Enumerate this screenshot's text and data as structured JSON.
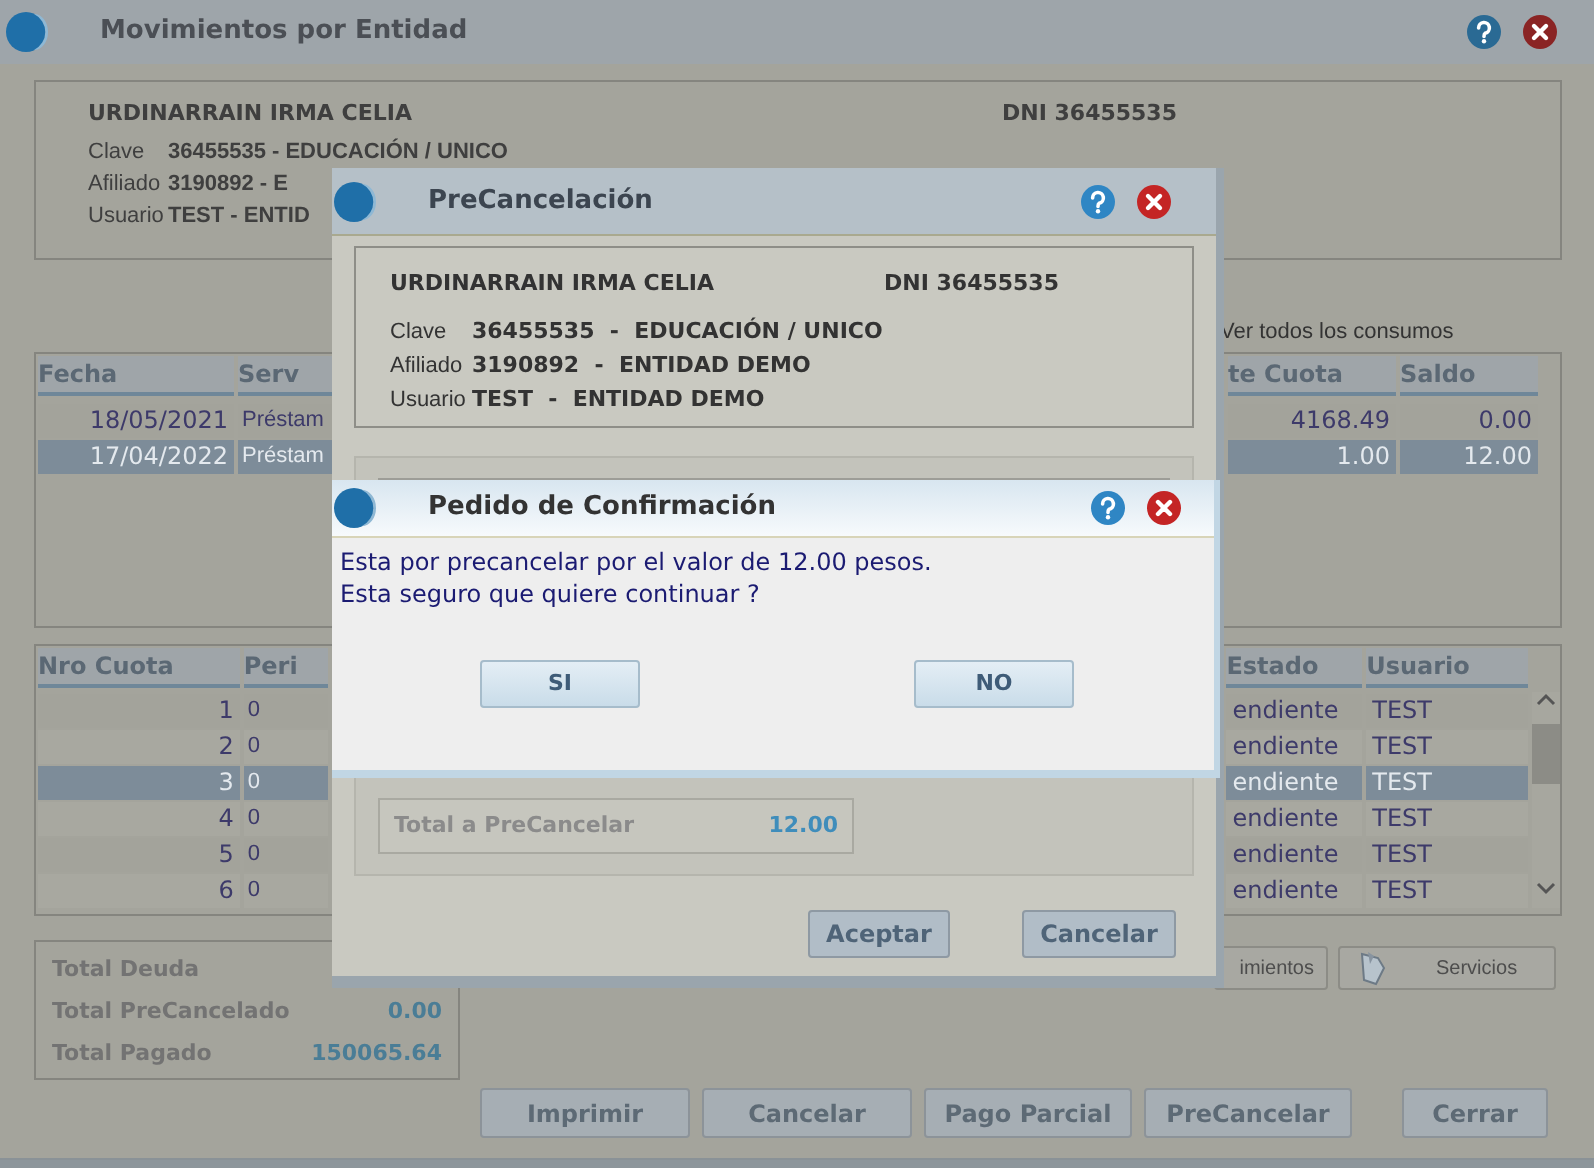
{
  "main": {
    "title": "Movimientos por Entidad",
    "header": {
      "name": "URDINARRAIN IRMA CELIA",
      "dni": "DNI 36455535",
      "rows": [
        {
          "label": "Clave",
          "value": "36455535 - EDUCACIÓN / UNICO"
        },
        {
          "label": "Afiliado",
          "value": "3190892 - E"
        },
        {
          "label": "Usuario",
          "value": "TEST - ENTID"
        }
      ]
    },
    "show_all_label": "Ver todos los consumos",
    "movements": {
      "columns": [
        "Fecha",
        "Serv",
        "te Cuota",
        "Saldo"
      ],
      "rows": [
        {
          "cells": [
            "18/05/2021",
            "Préstam",
            "4168.49",
            "0.00"
          ],
          "selected": false
        },
        {
          "cells": [
            "17/04/2022",
            "Préstam",
            "1.00",
            "12.00"
          ],
          "selected": true
        }
      ]
    },
    "installments": {
      "columns": [
        "Nro Cuota",
        "Peri",
        "Estado",
        "Usuario"
      ],
      "rows": [
        {
          "cells": [
            "1",
            "0",
            "endiente",
            "TEST"
          ],
          "selected": false
        },
        {
          "cells": [
            "2",
            "0",
            "endiente",
            "TEST"
          ],
          "selected": false
        },
        {
          "cells": [
            "3",
            "0",
            "endiente",
            "TEST"
          ],
          "selected": true
        },
        {
          "cells": [
            "4",
            "0",
            "endiente",
            "TEST"
          ],
          "selected": false
        },
        {
          "cells": [
            "5",
            "0",
            "endiente",
            "TEST"
          ],
          "selected": false
        },
        {
          "cells": [
            "6",
            "0",
            "endiente",
            "TEST"
          ],
          "selected": false
        }
      ]
    },
    "totals": [
      {
        "label": "Total Deuda"
      },
      {
        "label": "Total PreCancelado",
        "value": "0.00"
      },
      {
        "label": "Total Pagado",
        "value": "150065.64"
      }
    ],
    "side_buttons": [
      {
        "label": "imientos",
        "kind": "plain"
      },
      {
        "label": "Servicios",
        "kind": "icon"
      }
    ],
    "buttons": [
      "Imprimir",
      "Cancelar",
      "Pago Parcial",
      "PreCancelar",
      "Cerrar"
    ]
  },
  "precancel": {
    "title": "PreCancelación",
    "header": {
      "name": "URDINARRAIN IRMA CELIA",
      "dni": "DNI 36455535",
      "rows": [
        {
          "label": "Clave",
          "value": "36455535  -  EDUCACIÓN / UNICO"
        },
        {
          "label": "Afiliado",
          "value": "3190892  -  ENTIDAD DEMO"
        },
        {
          "label": "Usuario",
          "value": "TEST  -  ENTIDAD DEMO"
        }
      ]
    },
    "total": {
      "label": "Total a PreCancelar",
      "value": "12.00"
    },
    "buttons": [
      "Aceptar",
      "Cancelar"
    ]
  },
  "confirm": {
    "title": "Pedido de Confirmación",
    "message": [
      "Esta por precancelar por el valor de 12.00 pesos.",
      "Esta seguro que quiere continuar ?"
    ],
    "buttons": [
      "SI",
      "NO"
    ]
  }
}
